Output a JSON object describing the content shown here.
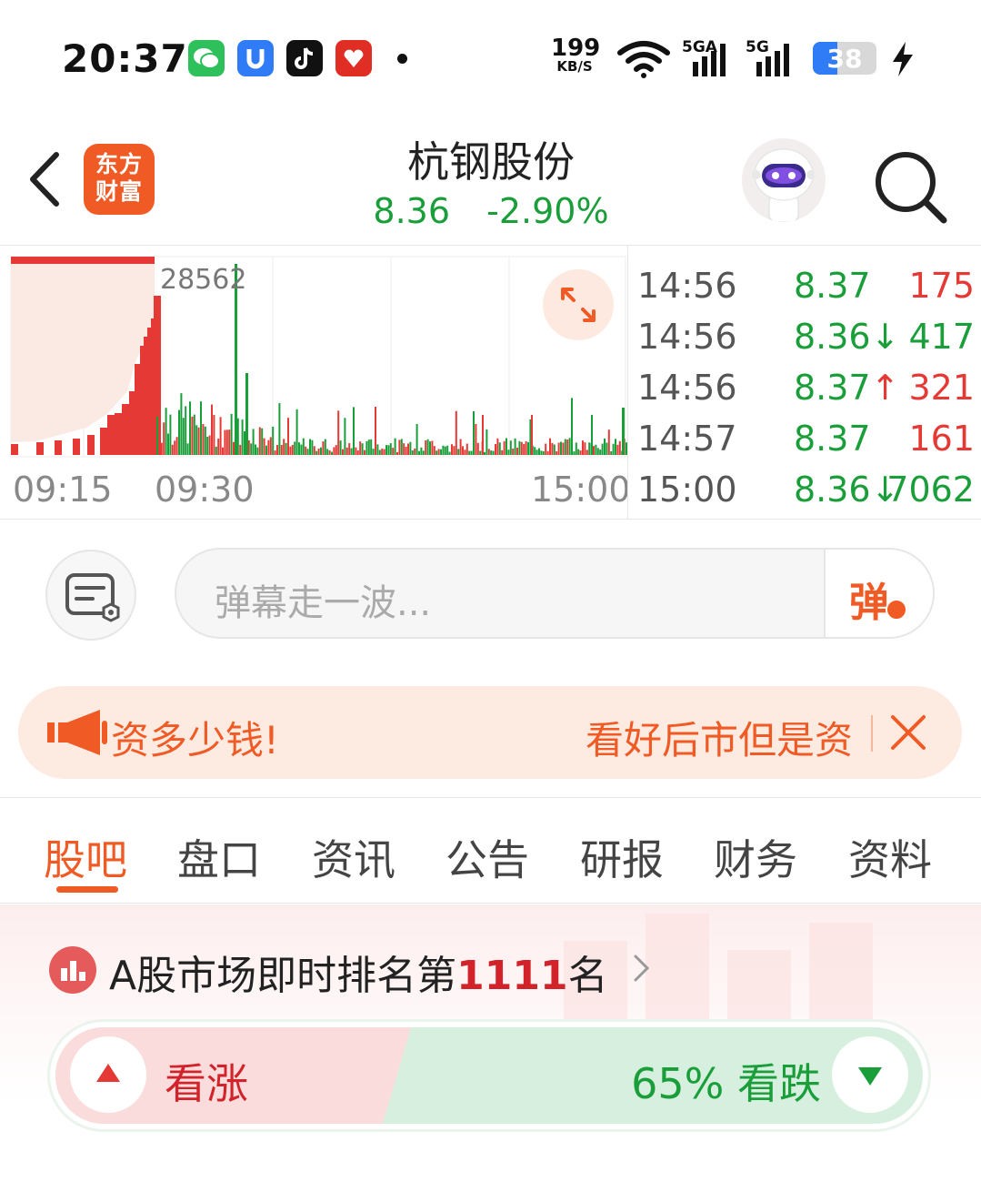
{
  "status_bar": {
    "time": "20:37",
    "apps": [
      "wechat-icon",
      "app-u-icon",
      "tiktok-icon",
      "pinduoduo-icon"
    ],
    "net_speed_value": "199",
    "net_speed_unit": "KB/S",
    "signal_labels": [
      "5GA",
      "5G"
    ],
    "battery": "38"
  },
  "header": {
    "logo_text_line1": "东方",
    "logo_text_line2": "财富",
    "stock_name": "杭钢股份",
    "price": "8.36",
    "change_pct": "-2.90%"
  },
  "chart": {
    "volume_label": "28562",
    "time_labels": [
      "09:15",
      "09:30",
      "15:00"
    ]
  },
  "chart_data": {
    "type": "bar",
    "title": "",
    "x_range": [
      "09:15",
      "15:00"
    ],
    "peak_volume_label": "28562",
    "colors": {
      "up": "#e53935",
      "down": "#1a9e3a"
    }
  },
  "trades": [
    {
      "time": "14:56",
      "price": "8.37",
      "dir": "",
      "volume": "175",
      "vol_color": "#e53935"
    },
    {
      "time": "14:56",
      "price": "8.36",
      "dir": "↓",
      "volume": "417",
      "vol_color": "#1a9e3a"
    },
    {
      "time": "14:56",
      "price": "8.37",
      "dir": "↑",
      "volume": "321",
      "vol_color": "#e53935"
    },
    {
      "time": "14:57",
      "price": "8.37",
      "dir": "",
      "volume": "161",
      "vol_color": "#e53935"
    },
    {
      "time": "15:00",
      "price": "8.36",
      "dir": "↓",
      "volume": "7062",
      "vol_color": "#1a9e3a"
    }
  ],
  "danmu": {
    "placeholder": "弹幕走一波...",
    "send_label": "弹"
  },
  "notice": {
    "text_left": "资多少钱!",
    "text_right": "看好后市但是资"
  },
  "tabs": [
    "股吧",
    "盘口",
    "资讯",
    "公告",
    "研报",
    "财务",
    "资料"
  ],
  "active_tab": 0,
  "ranking": {
    "prefix": "A股市场即时排名第",
    "rank": "1111",
    "suffix": "名"
  },
  "vote": {
    "bull_label": "看涨",
    "bear_label": "65% 看跌",
    "bear_pct": 65
  },
  "colors": {
    "brand": "#f05a24",
    "up": "#e53935",
    "down": "#1a9e3a"
  }
}
